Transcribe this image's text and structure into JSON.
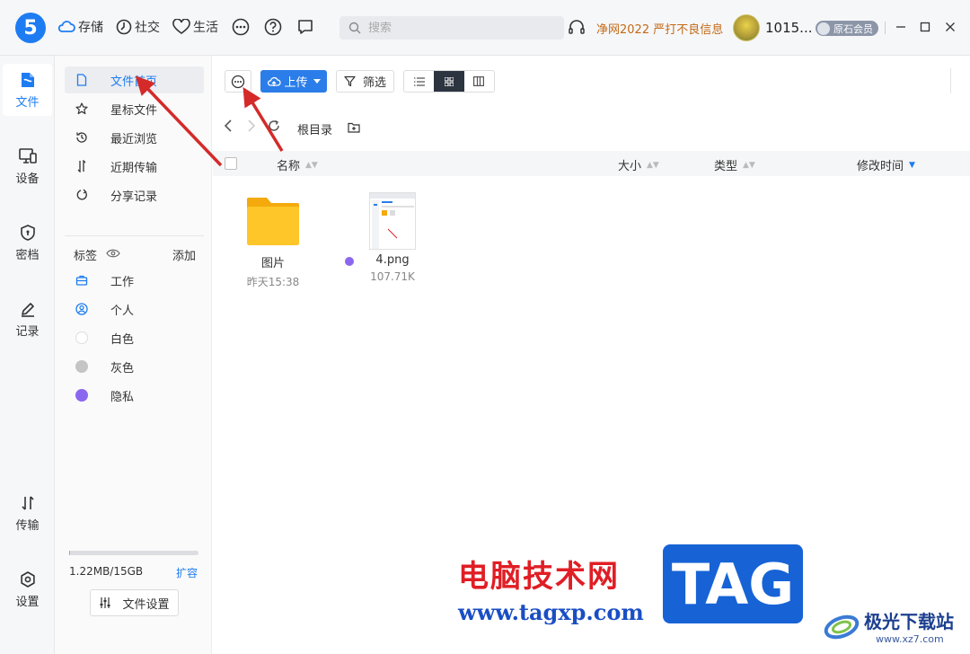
{
  "app": {
    "logo_char": "5",
    "accent": "#1e7cf2"
  },
  "topnav": {
    "items": [
      {
        "label": "存储",
        "icon": "cloud-icon"
      },
      {
        "label": "社交",
        "icon": "clock-icon"
      },
      {
        "label": "生活",
        "icon": "heart-icon"
      }
    ],
    "more_icon": "more-circle-icon",
    "help_icon": "question-icon",
    "chat_icon": "chat-bubble-icon"
  },
  "search": {
    "placeholder": "搜索"
  },
  "announcement": "净网2022 严打不良信息",
  "user": {
    "name": "1015...",
    "member_label": "原石会员"
  },
  "rail": {
    "items": [
      {
        "label": "文件",
        "icon": "file-icon",
        "active": true
      },
      {
        "label": "设备",
        "icon": "device-icon"
      },
      {
        "label": "密档",
        "icon": "shield-icon"
      },
      {
        "label": "记录",
        "icon": "pen-icon"
      },
      {
        "label": "传输",
        "icon": "transfer-icon"
      },
      {
        "label": "设置",
        "icon": "gear-icon"
      }
    ]
  },
  "sidebar": {
    "items": [
      {
        "label": "文件首页",
        "icon": "doc-icon",
        "active": true
      },
      {
        "label": "星标文件",
        "icon": "star-icon"
      },
      {
        "label": "最近浏览",
        "icon": "history-icon"
      },
      {
        "label": "近期传输",
        "icon": "transfer-icon"
      },
      {
        "label": "分享记录",
        "icon": "share-icon"
      }
    ],
    "tags_label": "标签",
    "tags_add": "添加",
    "tags": [
      {
        "label": "工作",
        "icon": "briefcase-icon"
      },
      {
        "label": "个人",
        "icon": "person-icon"
      },
      {
        "label": "白色",
        "color": "#ffffff"
      },
      {
        "label": "灰色",
        "color": "#c4c4c4"
      },
      {
        "label": "隐私",
        "color": "#8b67f0"
      }
    ],
    "storage": {
      "text": "1.22MB/15GB",
      "expand": "扩容",
      "fraction": 0.0001
    },
    "file_settings": "文件设置"
  },
  "toolbar": {
    "upload_label": "上传",
    "filter_label": "筛选"
  },
  "breadcrumb": "根目录",
  "columns": {
    "name": "名称",
    "size": "大小",
    "type": "类型",
    "modified": "修改时间"
  },
  "files": [
    {
      "name": "图片",
      "meta": "昨天15:38",
      "kind": "folder"
    },
    {
      "name": "4.png",
      "meta": "107.71K",
      "kind": "image",
      "tag_color": "#8b67f0"
    }
  ],
  "watermark": {
    "cn": "电脑技术网",
    "url": "www.tagxp.com",
    "tag": "TAG",
    "brand": "极光下载站",
    "brand_url": "www.xz7.com"
  }
}
